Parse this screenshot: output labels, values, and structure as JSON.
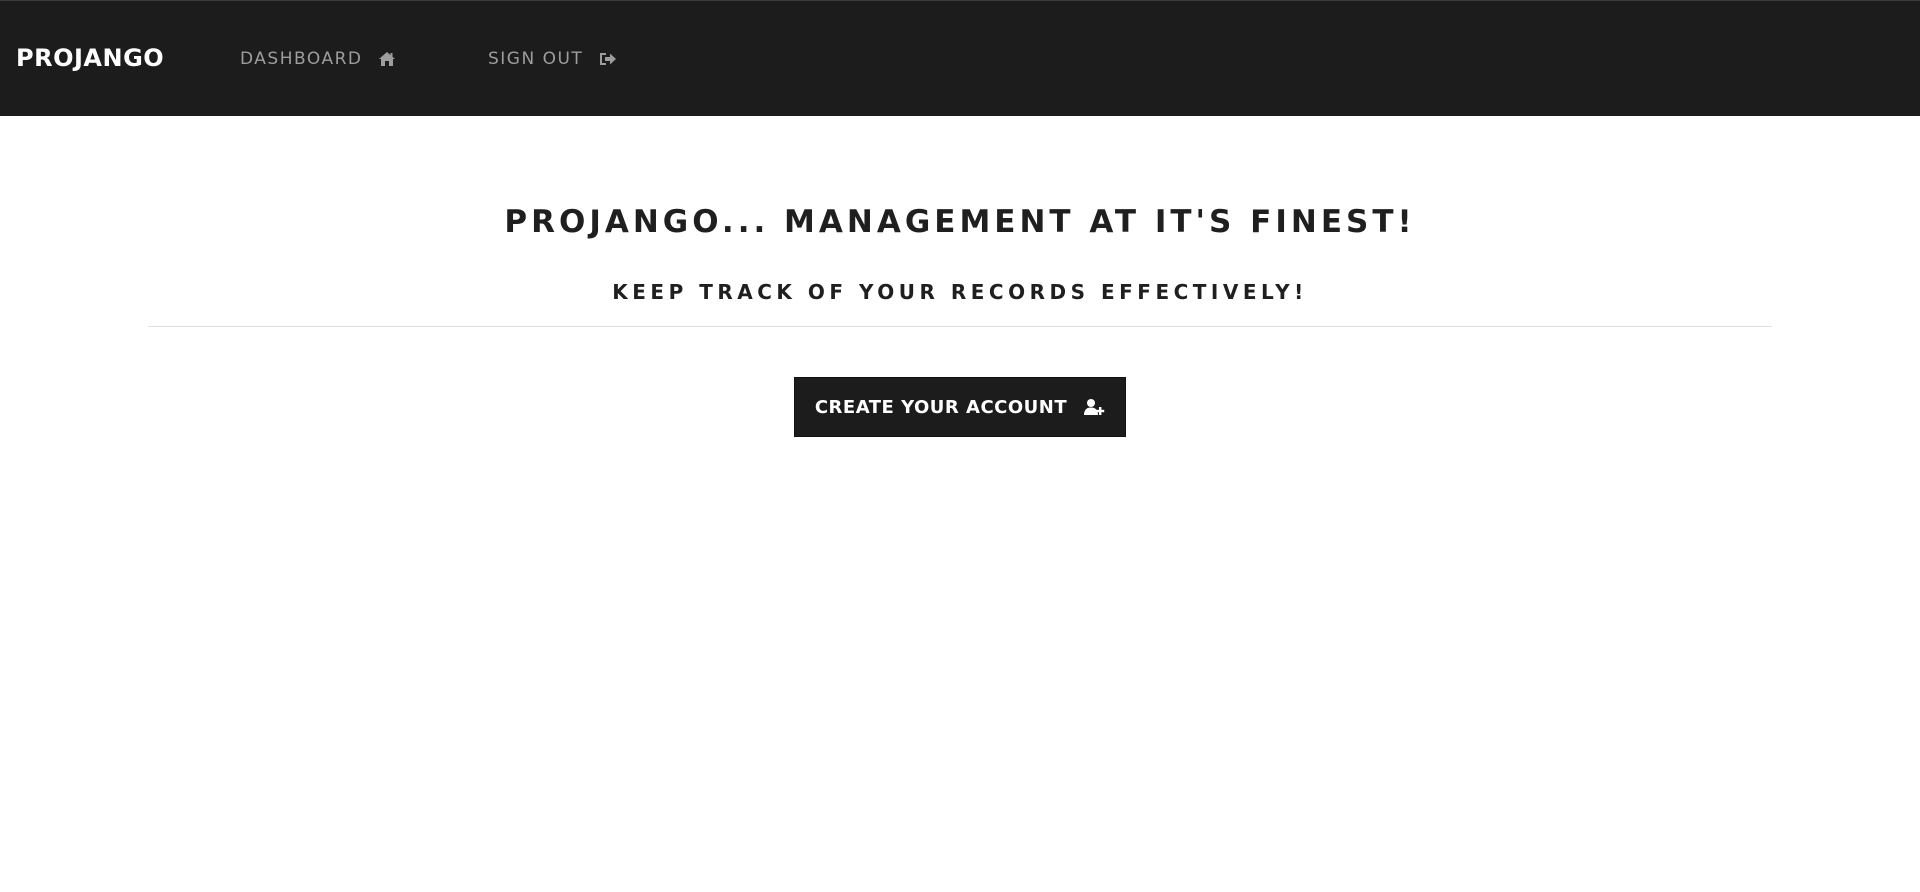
{
  "navbar": {
    "brand": "PROJANGO",
    "links": [
      {
        "label": "DASHBOARD",
        "icon": "home-icon"
      },
      {
        "label": "SIGN OUT",
        "icon": "sign-out-icon"
      }
    ],
    "background": "#1c1c1c",
    "link_color": "#9d9d9d"
  },
  "hero": {
    "title": "PROJANGO... MANAGEMENT AT IT'S FINEST!",
    "subtitle": "KEEP TRACK OF YOUR RECORDS EFFECTIVELY!",
    "cta": {
      "label": "CREATE YOUR ACCOUNT",
      "icon": "user-plus-icon"
    }
  }
}
